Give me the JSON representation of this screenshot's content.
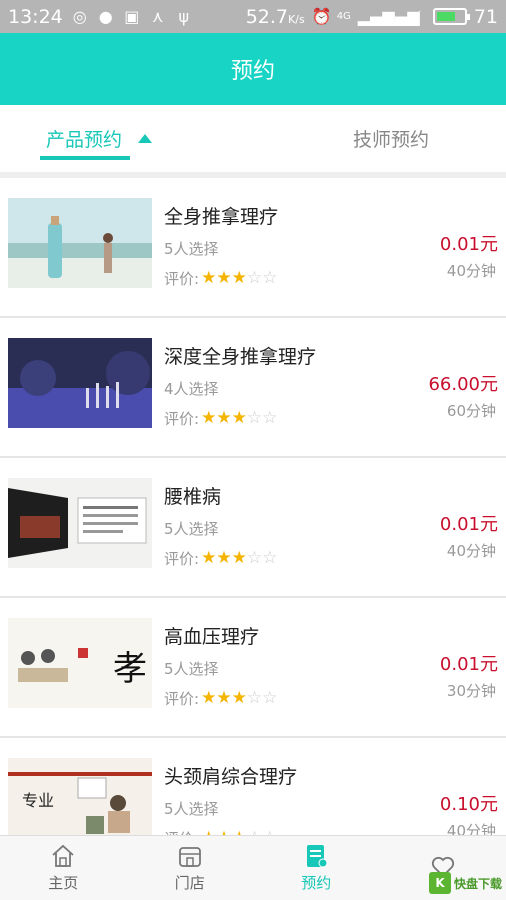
{
  "status_bar": {
    "time": "13:24",
    "speed": "52.7",
    "speed_unit": "K/s",
    "network": "4G",
    "battery": "71",
    "battery_level": 0.71
  },
  "header": {
    "title": "预约"
  },
  "tabs": [
    {
      "label": "产品预约",
      "active": true
    },
    {
      "label": "技师预约",
      "active": false
    }
  ],
  "rating_label": "评价:",
  "items": [
    {
      "name": "全身推拿理疗",
      "count": "5人选择",
      "price": "0.01元",
      "duration": "40分钟",
      "stars": 3
    },
    {
      "name": "深度全身推拿理疗",
      "count": "4人选择",
      "price": "66.00元",
      "duration": "60分钟",
      "stars": 3
    },
    {
      "name": "腰椎病",
      "count": "5人选择",
      "price": "0.01元",
      "duration": "40分钟",
      "stars": 3
    },
    {
      "name": "高血压理疗",
      "count": "5人选择",
      "price": "0.01元",
      "duration": "30分钟",
      "stars": 3
    },
    {
      "name": "头颈肩综合理疗",
      "count": "5人选择",
      "price": "0.10元",
      "duration": "40分钟",
      "stars": 3
    }
  ],
  "bottom_nav": [
    {
      "label": "主页",
      "icon": "home-icon"
    },
    {
      "label": "门店",
      "icon": "store-icon"
    },
    {
      "label": "预约",
      "icon": "appointment-icon",
      "active": true
    },
    {
      "label": "",
      "icon": "heart-icon"
    }
  ],
  "watermark": {
    "text": "快盘下载"
  }
}
